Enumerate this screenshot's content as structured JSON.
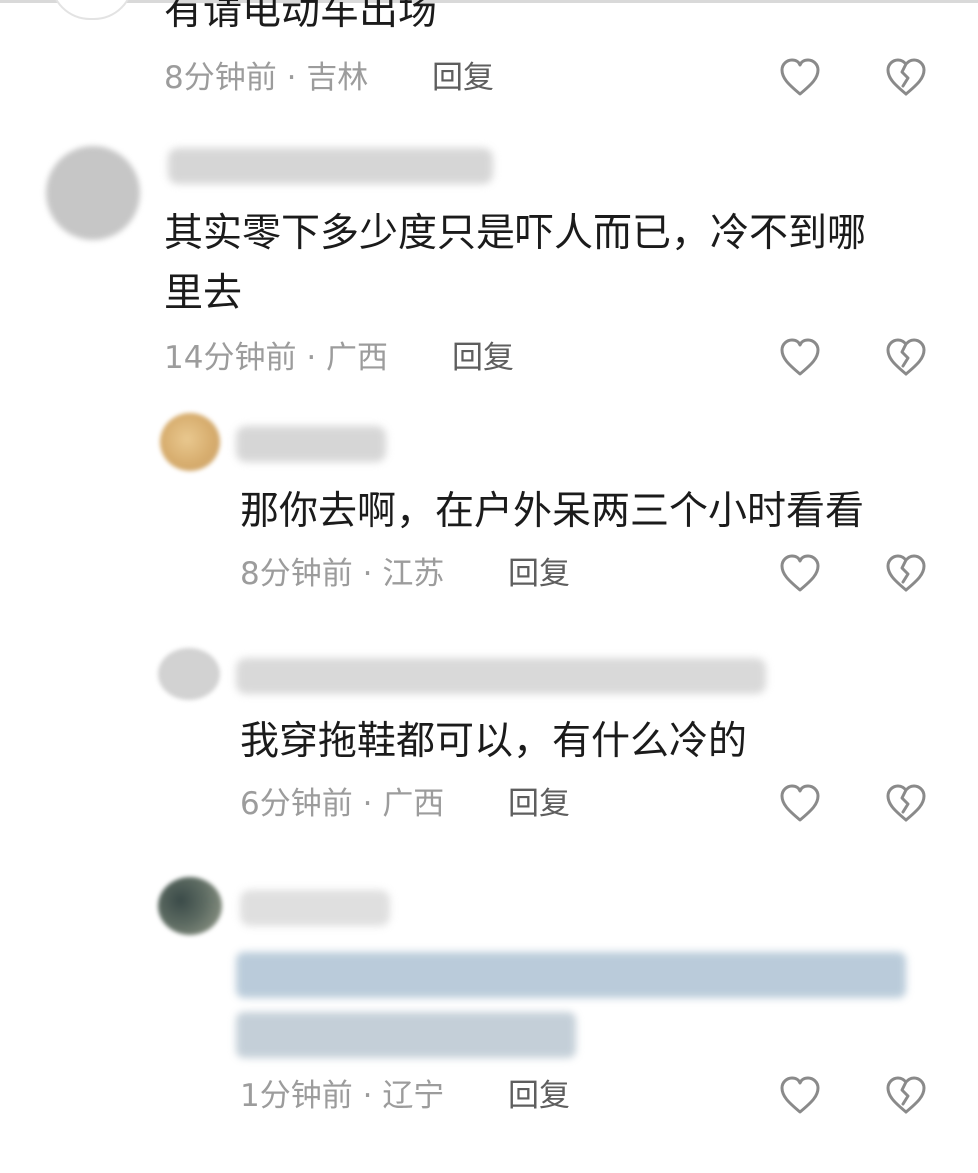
{
  "comments": [
    {
      "text": "有请电动车出场",
      "time": "8分钟前",
      "location": "吉林",
      "reply_label": "回复"
    },
    {
      "text_line1": "其实零下多少度只是吓人而已，冷不到哪",
      "text_line2": "里去",
      "time": "14分钟前",
      "location": "广西",
      "reply_label": "回复"
    },
    {
      "text": "那你去啊，在户外呆两三个小时看看",
      "time": "8分钟前",
      "location": "江苏",
      "reply_label": "回复"
    },
    {
      "text": "我穿拖鞋都可以，有什么冷的",
      "time": "6分钟前",
      "location": "广西",
      "reply_label": "回复"
    },
    {
      "time": "1分钟前",
      "location": "辽宁",
      "reply_label": "回复"
    }
  ],
  "separator": "·",
  "icons": {
    "like": "heart-outline-icon",
    "dislike": "broken-heart-outline-icon"
  }
}
